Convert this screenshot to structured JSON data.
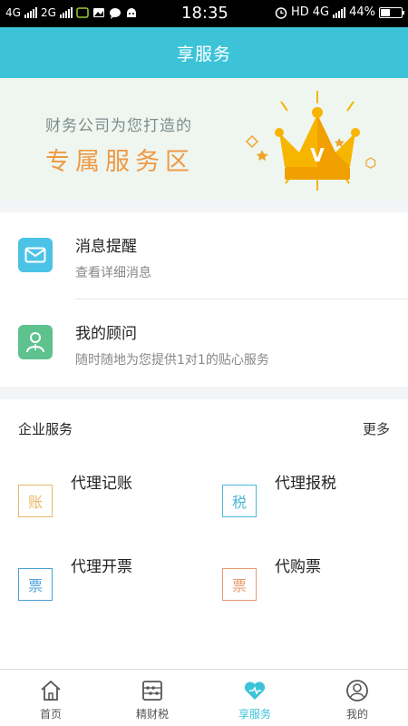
{
  "status_bar": {
    "net1": "4G",
    "net2": "2G",
    "time": "18:35",
    "hd": "HD",
    "net3": "4G",
    "battery_text": "44%",
    "battery_level": 0.44
  },
  "header": {
    "title": "享服务"
  },
  "banner": {
    "subtitle": "财务公司为您打造的",
    "title": "专属服务区",
    "crown_letter": "V"
  },
  "messages": [
    {
      "title": "消息提醒",
      "desc": "查看详细消息",
      "icon": "mail-icon",
      "color": "#4cc3e6"
    },
    {
      "title": "我的顾问",
      "desc": "随时随地为您提供1对1的贴心服务",
      "icon": "advisor-icon",
      "color": "#5ec28e"
    }
  ],
  "services": {
    "title": "企业服务",
    "more": "更多",
    "items": [
      {
        "label": "代理记账",
        "badge": "账",
        "color": "#e8b86b"
      },
      {
        "label": "代理报税",
        "badge": "税",
        "color": "#4cb8d8"
      },
      {
        "label": "代理开票",
        "badge": "票",
        "color": "#4aa0d8"
      },
      {
        "label": "代购票",
        "badge": "票",
        "color": "#e69a6e"
      }
    ]
  },
  "tabs": [
    {
      "label": "首页",
      "icon": "home-icon"
    },
    {
      "label": "精财税",
      "icon": "abacus-icon"
    },
    {
      "label": "享服务",
      "icon": "heart-icon",
      "active": true
    },
    {
      "label": "我的",
      "icon": "profile-icon"
    }
  ],
  "colors": {
    "accent": "#3cc3d8",
    "banner_title": "#ee9a45",
    "crown": "#f5b400"
  }
}
